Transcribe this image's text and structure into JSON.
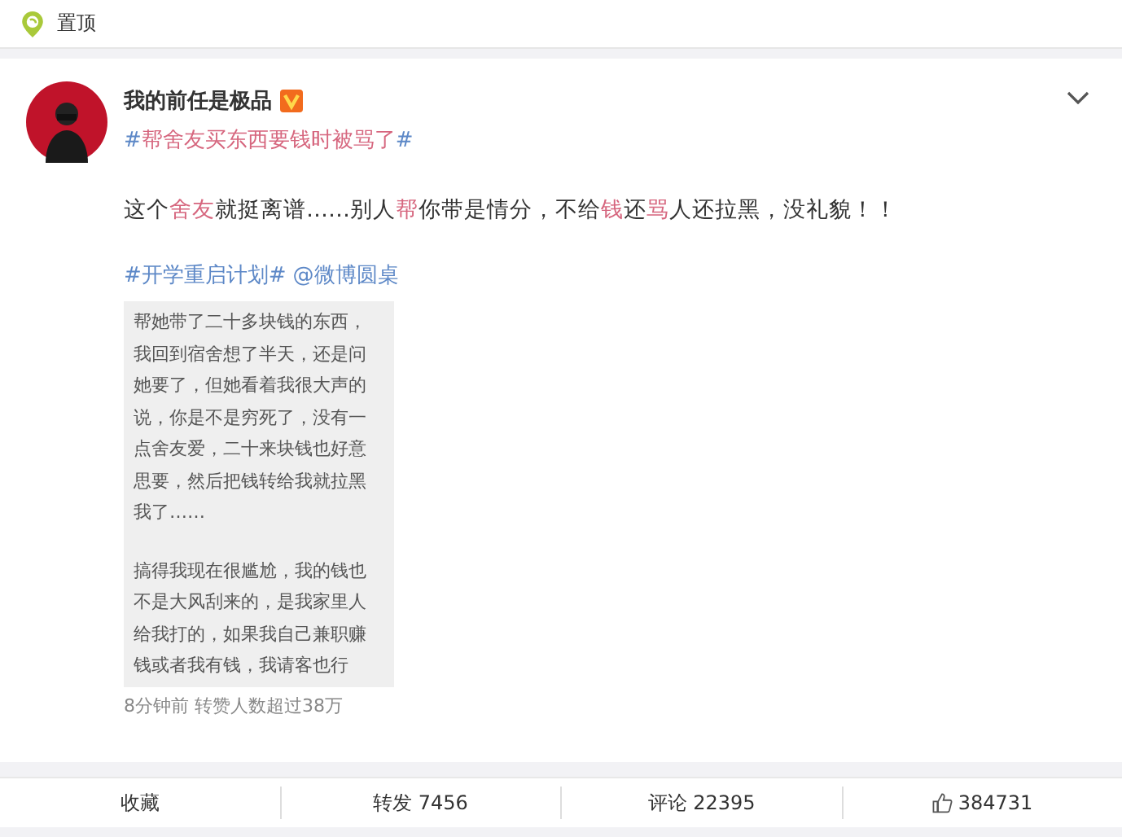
{
  "top_bar": {
    "label": "置顶"
  },
  "post": {
    "author": "我的前任是极品",
    "verified": true,
    "topic": {
      "hash_open": "#",
      "text": "帮舍友买东西要钱时被骂了",
      "hash_close": "#"
    },
    "body": [
      {
        "text": "这个",
        "highlight": false
      },
      {
        "text": "舍友",
        "highlight": true
      },
      {
        "text": "就挺离谱……别人",
        "highlight": false
      },
      {
        "text": "帮",
        "highlight": true
      },
      {
        "text": "你带是情分，不给",
        "highlight": false
      },
      {
        "text": "钱",
        "highlight": true
      },
      {
        "text": "还",
        "highlight": false
      },
      {
        "text": "骂",
        "highlight": true
      },
      {
        "text": "人还拉黑，没礼貌！！",
        "highlight": false
      }
    ],
    "tags": [
      "#开学重启计划#",
      "@微博圆桌"
    ],
    "image_text": [
      [
        "帮她带了二十多块钱的东西，",
        "我回到宿舍想了半天，还是问",
        "她要了，但她看着我很大声的",
        "说，你是不是穷死了，没有一",
        "点舍友爱，二十来块钱也好意",
        "思要，然后把钱转给我就拉黑",
        "我了……"
      ],
      [
        "搞得我现在很尴尬，我的钱也",
        "不是大风刮来的，是我家里人",
        "给我打的，如果我自己兼职赚",
        "钱或者我有钱，我请客也行"
      ]
    ],
    "meta": "8分钟前 转赞人数超过38万"
  },
  "actions": [
    {
      "kind": "text",
      "label": "收藏"
    },
    {
      "kind": "text",
      "label": "转发 7456"
    },
    {
      "kind": "text",
      "label": "评论 22395"
    },
    {
      "kind": "like",
      "label": "384731"
    }
  ]
}
